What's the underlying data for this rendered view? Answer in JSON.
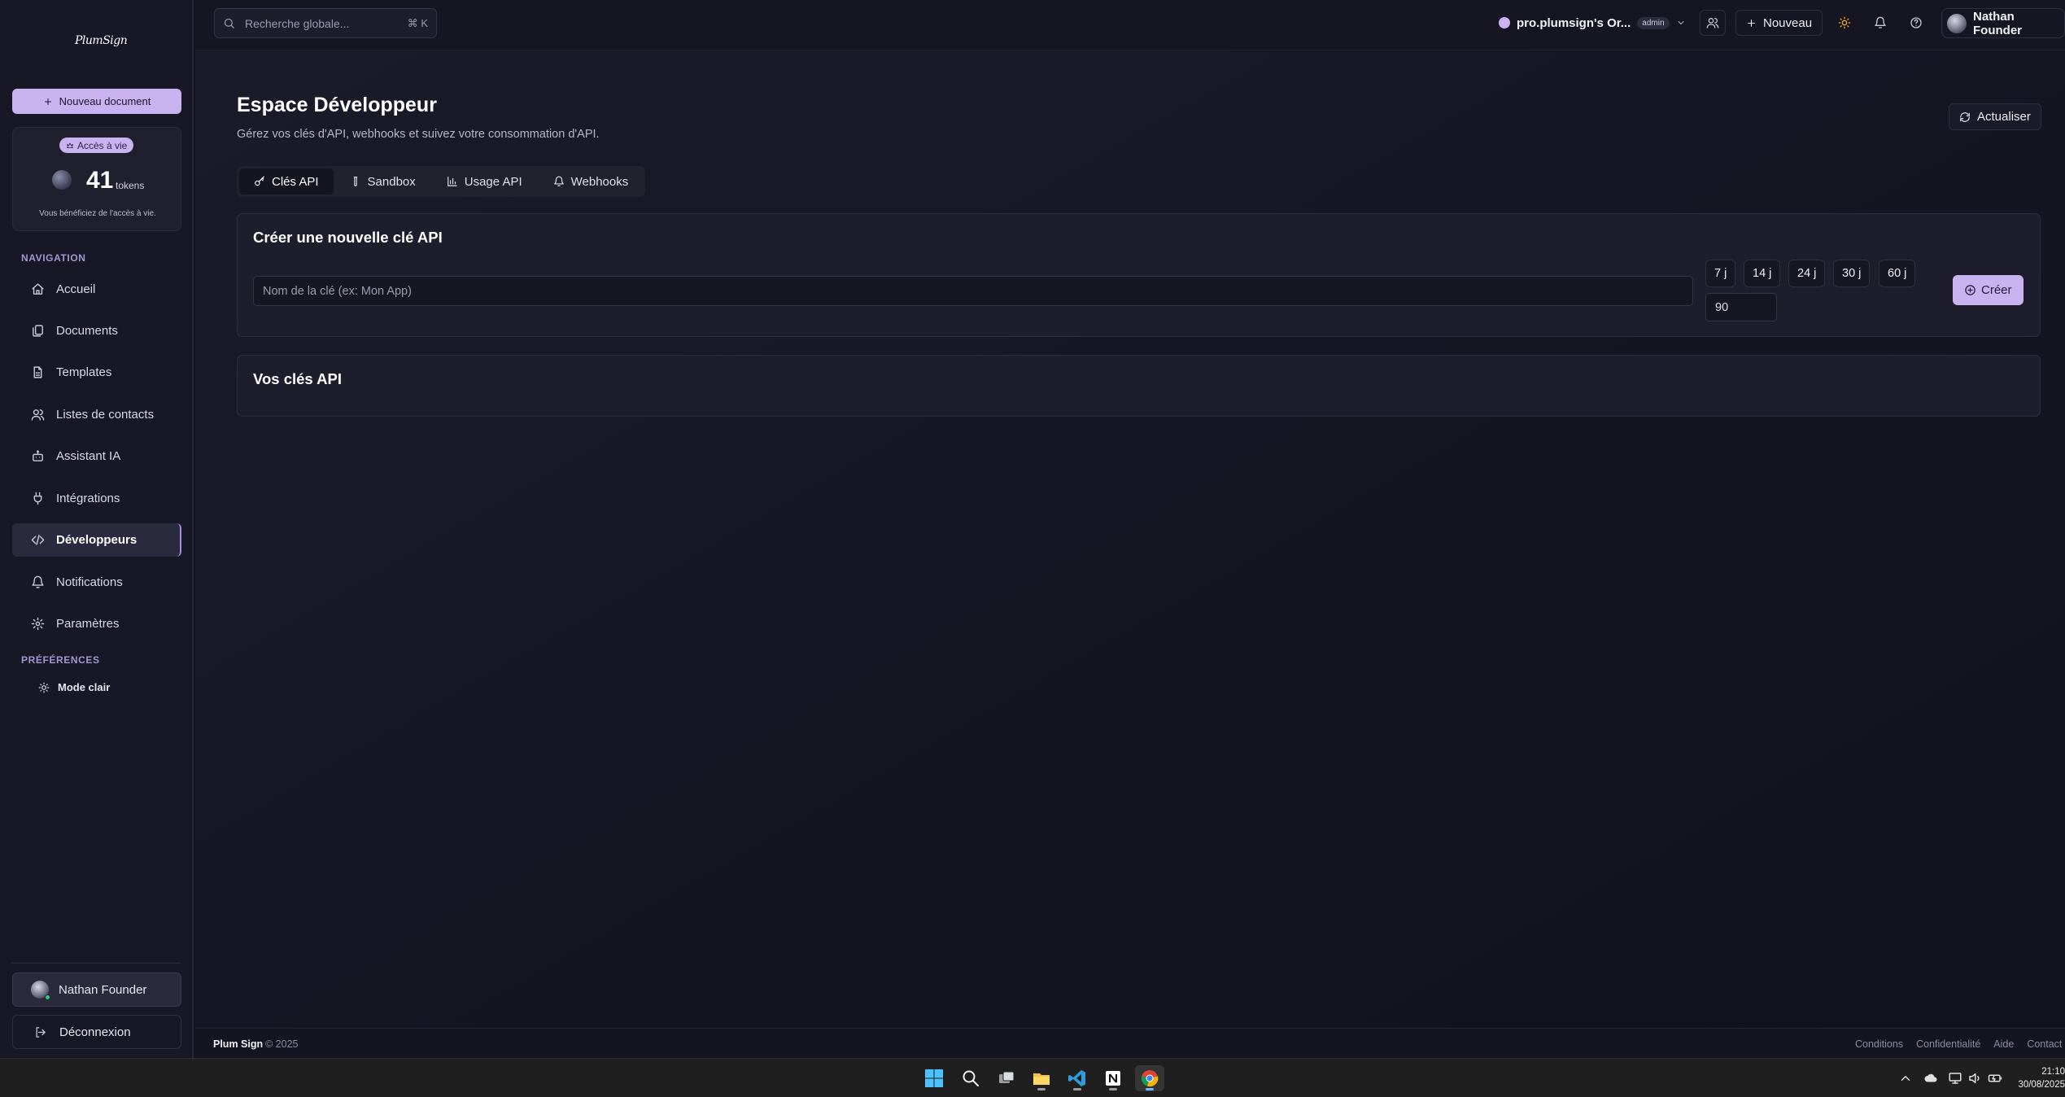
{
  "app": {
    "logo_text": "PlumSign"
  },
  "sidebar": {
    "new_document_label": "Nouveau document",
    "token_card": {
      "badge": "Accès à vie",
      "count": "41",
      "unit": "tokens",
      "note": "Vous bénéficiez de l'accès à vie."
    },
    "navigation_label": "NAVIGATION",
    "items": [
      {
        "label": "Accueil",
        "icon": "home-icon"
      },
      {
        "label": "Documents",
        "icon": "documents-icon"
      },
      {
        "label": "Templates",
        "icon": "file-text-icon"
      },
      {
        "label": "Listes de contacts",
        "icon": "users-icon"
      },
      {
        "label": "Assistant IA",
        "icon": "bot-icon"
      },
      {
        "label": "Intégrations",
        "icon": "plug-icon"
      },
      {
        "label": "Développeurs",
        "icon": "code-icon",
        "active": true
      },
      {
        "label": "Notifications",
        "icon": "bell-icon"
      },
      {
        "label": "Paramètres",
        "icon": "gear-icon"
      }
    ],
    "preferences_label": "PRÉFÉRENCES",
    "mode_label": "Mode clair",
    "user_name": "Nathan Founder",
    "logout_label": "Déconnexion"
  },
  "topbar": {
    "search_placeholder": "Recherche globale...",
    "search_shortcut": "⌘ K",
    "org_name": "pro.plumsign's Or...",
    "org_role": "admin",
    "new_label": "Nouveau",
    "user_name": "Nathan Founder"
  },
  "main": {
    "title": "Espace Développeur",
    "subtitle": "Gérez vos clés d'API, webhooks et suivez votre consommation d'API.",
    "refresh_label": "Actualiser",
    "tabs": [
      {
        "label": "Clés API",
        "icon": "key-icon",
        "active": true
      },
      {
        "label": "Sandbox",
        "icon": "flask-icon"
      },
      {
        "label": "Usage API",
        "icon": "bar-chart-icon"
      },
      {
        "label": "Webhooks",
        "icon": "bell-icon"
      }
    ],
    "create_card": {
      "title": "Créer une nouvelle clé API",
      "name_placeholder": "Nom de la clé (ex: Mon App)",
      "durations": [
        "7 j",
        "14 j",
        "24 j",
        "30 j",
        "60 j"
      ],
      "days_value": "90",
      "create_label": "Créer"
    },
    "keys_card": {
      "title": "Vos clés API"
    }
  },
  "footer": {
    "brand": "Plum Sign",
    "copyright": "© 2025",
    "links": [
      "Conditions",
      "Confidentialité",
      "Aide",
      "Contact"
    ]
  },
  "taskbar": {
    "time": "21:10",
    "date": "30/08/2025"
  },
  "colors": {
    "accent": "#c8b2f0",
    "background": "#14141f",
    "sidebar": "#171725",
    "card": "#1d1d2b",
    "sun": "#f5a623"
  }
}
